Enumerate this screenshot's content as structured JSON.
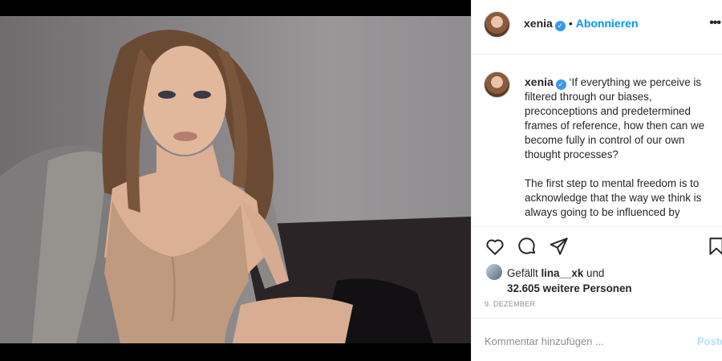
{
  "post": {
    "author": "xenia",
    "follow_label": "Abonnieren",
    "separator": "•",
    "more_label": "•••",
    "verified_mark": "✓",
    "caption_text": "‘If everything we perceive is filtered through our biases, preconceptions and predetermined frames of reference, how then can we become fully in control of our own thought processes?\n\nThe first step to mental freedom is to acknowledge that the way we think is always going to be influenced by",
    "likes_prefix": "Gefällt",
    "likes_user": "lina__xk",
    "likes_and": "und",
    "likes_others": "32.605 weitere Personen",
    "date": "9. DEZEMBER",
    "comment_placeholder": "Kommentar hinzufügen ...",
    "post_button": "Posten"
  },
  "icons": {
    "like": "heart-icon",
    "comment": "comment-icon",
    "share": "share-icon",
    "save": "bookmark-icon",
    "verified": "verified-icon",
    "more": "more-options-icon"
  },
  "colors": {
    "accent": "#0095f6",
    "verified": "#3897f0",
    "text": "#262626",
    "muted": "#8e8e8e"
  }
}
